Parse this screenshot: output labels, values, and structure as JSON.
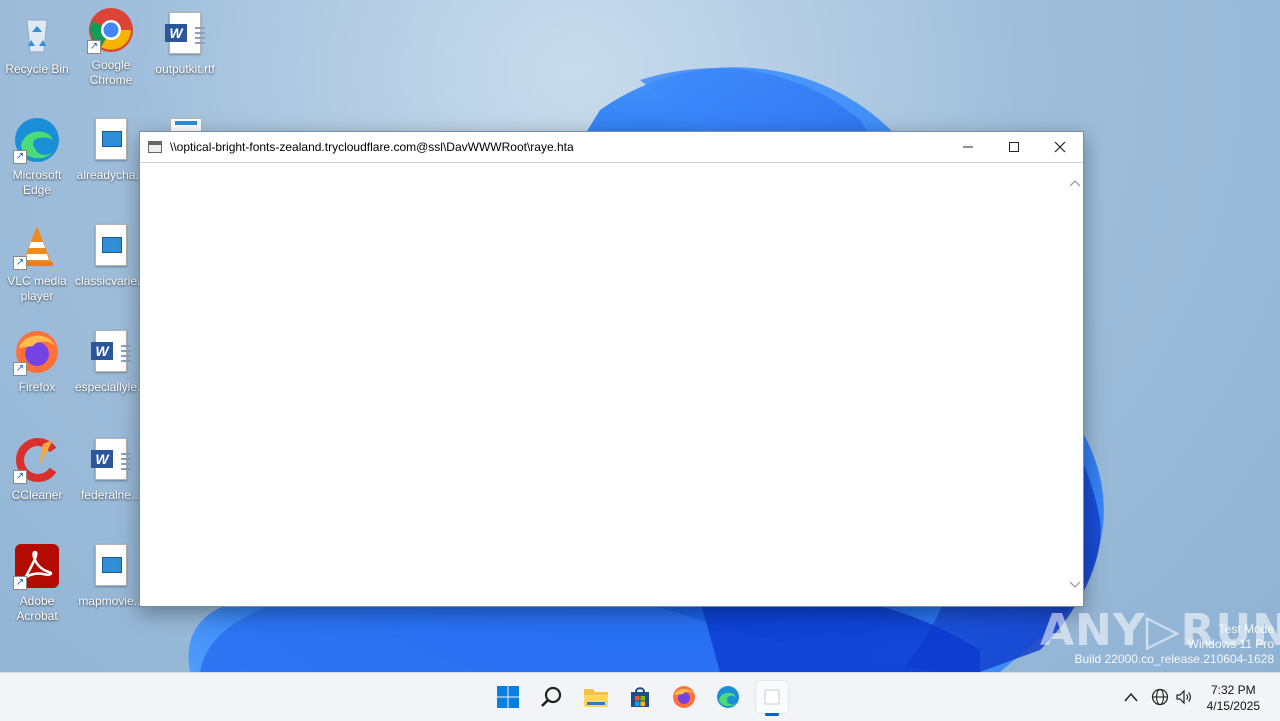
{
  "desktop": {
    "icons": [
      {
        "label": "Recycle Bin"
      },
      {
        "label": "Google Chrome"
      },
      {
        "label": "outputkit.rtf"
      },
      {
        "label": "Microsoft Edge"
      },
      {
        "label": "alreadycha..."
      },
      {
        "label": "VLC media player"
      },
      {
        "label": "classicvarie..."
      },
      {
        "label": "Firefox"
      },
      {
        "label": "especiallyle..."
      },
      {
        "label": "CCleaner"
      },
      {
        "label": "federalne..."
      },
      {
        "label": "Adobe Acrobat"
      },
      {
        "label": "mapmovie..."
      }
    ]
  },
  "window": {
    "title": "\\\\optical-bright-fonts-zealand.trycloudflare.com@ssl\\DavWWWRoot\\raye.hta",
    "minimize_glyph": "—",
    "maximize_glyph": "☐",
    "close_glyph": "✕",
    "scroll_up_glyph": "⌃",
    "scroll_down_glyph": "⌄"
  },
  "watermark": {
    "brand": "ANY▷RUN",
    "test_mode": "Test Mode",
    "edition": "Windows 11 Pro",
    "build": "Build 22000.co_release.210604-1628"
  },
  "taskbar": {
    "apps": [
      "start-icon",
      "search-icon",
      "file-explorer-icon",
      "store-icon",
      "firefox-icon",
      "edge-icon",
      "hta-app-icon"
    ],
    "tray": {
      "chevron": "^",
      "network_glyph": "🌐",
      "volume_glyph": "🔈"
    },
    "time": "7:32 PM",
    "date": "4/15/2025"
  }
}
